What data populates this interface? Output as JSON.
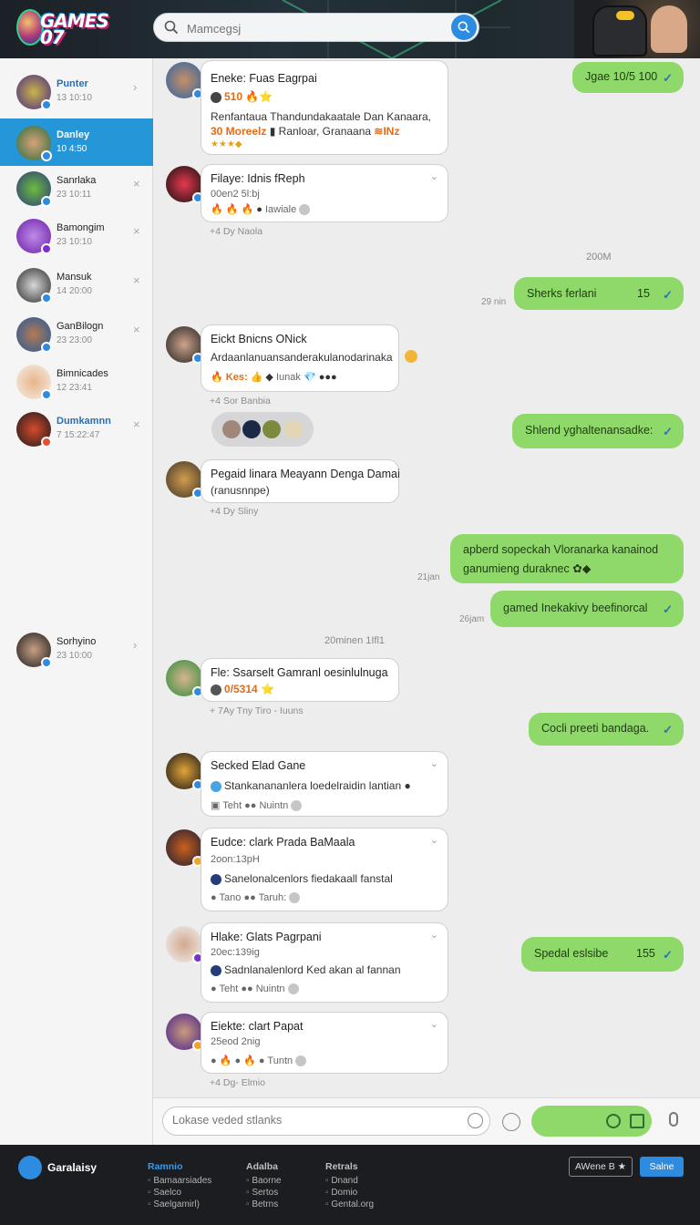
{
  "header": {
    "logo_text": "GAMES 07",
    "search_placeholder": "Mamcegsj"
  },
  "contacts": [
    {
      "name": "Punter",
      "sub": "13 10:10",
      "active": false
    },
    {
      "name": "Danley",
      "sub": "10 4:50",
      "active": true
    },
    {
      "name": "Sanrlaka",
      "sub": "23 10:11",
      "active": false
    },
    {
      "name": "Bamongim",
      "sub": "23 10:10",
      "active": false
    },
    {
      "name": "Mansuk",
      "sub": "14 20:00",
      "active": false
    },
    {
      "name": "GanBilogn",
      "sub": "23 23:00",
      "active": false
    },
    {
      "name": "Bimnicades",
      "sub": "12 23:41",
      "active": false
    },
    {
      "name": "Dumkamnn",
      "sub": "7 15:22:47",
      "active": false
    },
    {
      "name": "Sorhyino",
      "sub": "23 10:00",
      "active": false
    }
  ],
  "messages": {
    "m1": {
      "title": "Eneke: Fuas Eagrpai",
      "line2": "510",
      "line3": "Renfantaua Thandundakaatale Dan Kanaara,",
      "line4a": "30 Moreelz",
      "line4b": "Ranloar, Granaana",
      "line4c": "≋INz"
    },
    "m2": {
      "title": "Filaye: Idnis fReph",
      "line2": "00en2 5l:bj",
      "line3": "Iawiale",
      "meta": "+4 Dy  Naola"
    },
    "m3": {
      "title": "Eickt Bnicns ONick",
      "line2": "Ardaanlanuansanderakulanodarinaka",
      "line3": "Kes:",
      "line3b": "Iunak",
      "meta": "+4 Sor  Banbia"
    },
    "m4": {
      "title": "Pegaid linara Meayann Denga Damai",
      "line2": "(ranusnnpe)",
      "meta": "+4 Dy  Sliny"
    },
    "m5": {
      "title": "Fle: Ssarselt Gamranl oesinlulnuga",
      "line2": "0/5314",
      "meta": "+ 7Ay  Tny  Tiro - Iuuns"
    },
    "m6": {
      "title": "Secked Elad Gane",
      "line2": "Stankanananlera loedelraidin lantian",
      "line3": "Teht",
      "line3b": "Nuintn"
    },
    "m7": {
      "title": "Eudce: clark Prada BaMaala",
      "line2": "2oon:13pH",
      "line3": "Sanelonalcenlors fiedakaall fanstal",
      "line4": "Tano",
      "line4b": "Taruh:"
    },
    "m8": {
      "title": "Hlake: Glats Pagrpani",
      "line2": "20ec:139ig",
      "line3": "Sadnlanalenlord Ked akan al fannan",
      "line4": "Teht",
      "line4b": "Nuintn"
    },
    "m9": {
      "title": "Eiekte: clart Papat",
      "line2": "25eod 2nig",
      "line3": "Tuntn",
      "meta": "+4 Dg-  Elmio"
    }
  },
  "outgoing": {
    "o1": {
      "text": "Jgae 10/5 100"
    },
    "o2": {
      "text": "Sherks ferlani",
      "num": "15",
      "time": "29 nin"
    },
    "o3": {
      "text": "Shlend yghaltenansadke:"
    },
    "o4": {
      "line1": "apberd sopeckah Vloranarka kanainod",
      "line2": "ganumieng duraknec",
      "time": "21jan"
    },
    "o5": {
      "text": "gamed Inekakivy beefinorcal",
      "time": "26jam"
    },
    "o6": {
      "text": "Cocli preeti bandaga."
    },
    "o7": {
      "text": "Spedal eslsibe",
      "num": "155"
    }
  },
  "separators": {
    "s1": "200M",
    "s2": "20minen 1Ifl1"
  },
  "composer": {
    "placeholder": "Lokase veded stlanks"
  },
  "footer": {
    "brand": "Garalaisy",
    "col1": {
      "title": "Ramnio",
      "items": [
        "Bamaarsiades",
        "Saelco",
        "Saelgamirl)"
      ]
    },
    "col2": {
      "title": "Adalba",
      "items": [
        "Baorne",
        "Sertos",
        "Betrns"
      ]
    },
    "col3": {
      "title": "Retrals",
      "items": [
        "Dnand",
        "Domio",
        "Gental.org"
      ]
    },
    "btn1": "AWene B ★",
    "btn2": "Salne"
  },
  "colors": {
    "accent": "#2596d8",
    "outgoing_bubble": "#8fd86a",
    "footer_bg": "#1c1d20"
  }
}
